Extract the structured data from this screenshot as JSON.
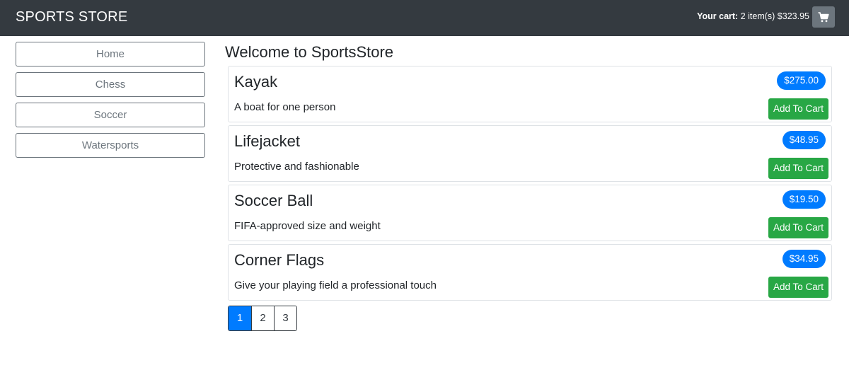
{
  "navbar": {
    "brand": "SPORTS STORE",
    "cart_label": "Your cart:",
    "cart_text": "2 item(s) $323.95",
    "cart_icon": "shopping-cart-icon"
  },
  "categories": [
    {
      "label": "Home"
    },
    {
      "label": "Chess"
    },
    {
      "label": "Soccer"
    },
    {
      "label": "Watersports"
    }
  ],
  "main": {
    "title": "Welcome to SportsStore"
  },
  "products": [
    {
      "name": "Kayak",
      "description": "A boat for one person",
      "price": "$275.00",
      "button": "Add To Cart"
    },
    {
      "name": "Lifejacket",
      "description": "Protective and fashionable",
      "price": "$48.95",
      "button": "Add To Cart"
    },
    {
      "name": "Soccer Ball",
      "description": "FIFA-approved size and weight",
      "price": "$19.50",
      "button": "Add To Cart"
    },
    {
      "name": "Corner Flags",
      "description": "Give your playing field a professional touch",
      "price": "$34.95",
      "button": "Add To Cart"
    }
  ],
  "pagination": {
    "pages": [
      "1",
      "2",
      "3"
    ],
    "current": "1"
  },
  "colors": {
    "navbar": "#343a40",
    "price_badge": "#007bff",
    "add_button": "#28a745",
    "cart_button": "#6c757d",
    "active_page": "#007bff"
  }
}
